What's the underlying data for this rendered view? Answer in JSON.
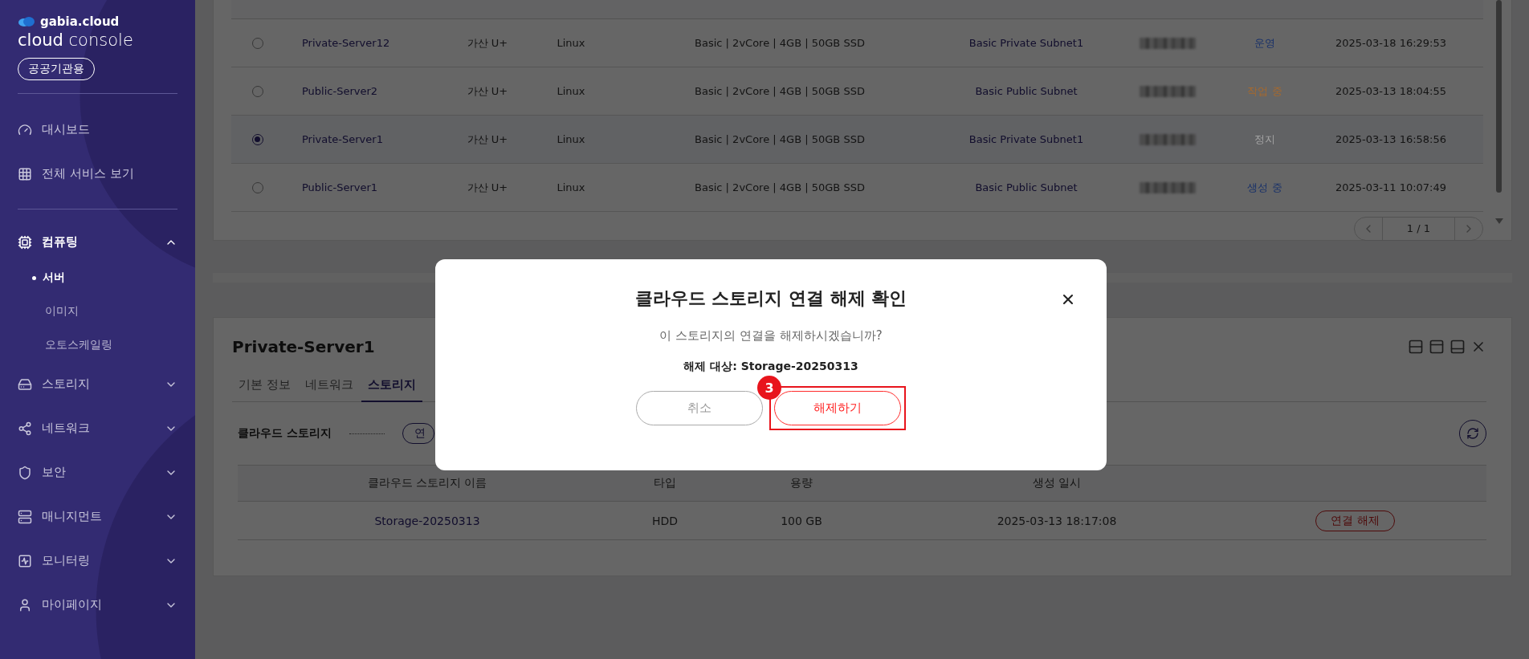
{
  "sidebar": {
    "brand": "gabia.cloud",
    "product": "**cloud** console",
    "badge": "공공기관용",
    "top_items": [
      {
        "label": "대시보드"
      },
      {
        "label": "전체 서비스 보기"
      }
    ],
    "menu": [
      {
        "label": "컴퓨팅",
        "expanded": true,
        "children": [
          {
            "label": "서버",
            "selected": true
          },
          {
            "label": "이미지",
            "selected": false
          },
          {
            "label": "오토스케일링",
            "selected": false
          }
        ]
      },
      {
        "label": "스토리지",
        "expanded": false
      },
      {
        "label": "네트워크",
        "expanded": false
      },
      {
        "label": "보안",
        "expanded": false
      },
      {
        "label": "매니지먼트",
        "expanded": false
      },
      {
        "label": "모니터링",
        "expanded": false
      },
      {
        "label": "마이페이지",
        "expanded": false
      }
    ]
  },
  "server_table": {
    "rows": [
      {
        "selected": false,
        "name": "Private-Server12",
        "zone": "가산 U+",
        "os": "Linux",
        "spec": "Basic | 2vCore | 4GB | 50GB SSD",
        "subnet": "Basic Private Subnet1",
        "status": "운영",
        "color": "#17306a",
        "created": "2025-03-18 16:29:53"
      },
      {
        "selected": false,
        "name": "Public-Server2",
        "zone": "가산 U+",
        "os": "Linux",
        "spec": "Basic | 2vCore | 4GB | 50GB SSD",
        "subnet": "Basic Public Subnet",
        "status": "작업 중",
        "color": "#a8692c",
        "created": "2025-03-13 18:04:55"
      },
      {
        "selected": true,
        "name": "Private-Server1",
        "zone": "가산 U+",
        "os": "Linux",
        "spec": "Basic | 2vCore | 4GB | 50GB SSD",
        "subnet": "Basic Private Subnet1",
        "status": "정지",
        "color": "#a4a4a4",
        "created": "2025-03-13 16:58:56"
      },
      {
        "selected": false,
        "name": "Public-Server1",
        "zone": "가산 U+",
        "os": "Linux",
        "spec": "Basic | 2vCore | 4GB | 50GB SSD",
        "subnet": "Basic Public Subnet",
        "status": "생성 중",
        "color": "#17306a",
        "created": "2025-03-11 10:07:49"
      }
    ],
    "pagination": "1 / 1"
  },
  "detail_panel": {
    "title": "Private-Server1",
    "tabs": [
      {
        "label": "기본 정보",
        "selected": false
      },
      {
        "label": "네트워크",
        "selected": false
      },
      {
        "label": "스토리지",
        "selected": true
      }
    ],
    "section_label": "클라우드 스토리지",
    "section_button": "연",
    "columns": [
      "클라우드 스토리지 이름",
      "타입",
      "용량",
      "생성 일시"
    ],
    "rows": [
      {
        "name": "Storage-20250313",
        "type": "HDD",
        "capacity": "100 GB",
        "created": "2025-03-13 18:17:08",
        "action": "연결 해제"
      }
    ]
  },
  "modal": {
    "title": "클라우드 스토리지 연결 해제 확인",
    "message": "이 스토리지의 연결을 해제하시겠습니까?",
    "target": "해제 대상: Storage-20250313",
    "cancel": "취소",
    "confirm": "해제하기",
    "step_marker": "3"
  }
}
